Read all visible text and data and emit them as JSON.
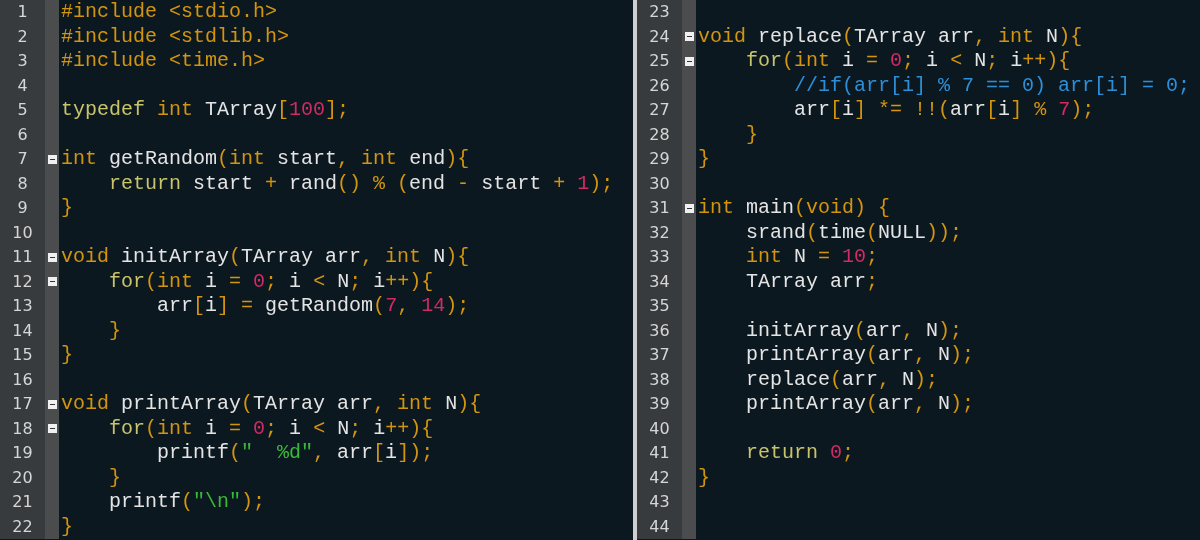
{
  "panes": [
    {
      "lines": [
        {
          "number": "1",
          "fold": false,
          "tokens": [
            {
              "text": "#include <stdio.h>",
              "kind": "pp"
            }
          ]
        },
        {
          "number": "2",
          "fold": false,
          "tokens": [
            {
              "text": "#include <stdlib.h>",
              "kind": "pp"
            }
          ]
        },
        {
          "number": "3",
          "fold": false,
          "tokens": [
            {
              "text": "#include <time.h>",
              "kind": "pp"
            }
          ]
        },
        {
          "number": "4",
          "fold": false
        },
        {
          "number": "5",
          "fold": false,
          "tokens": [
            {
              "text": "typedef",
              "kind": "kw"
            },
            {
              "text": " int",
              "kind": "type"
            },
            {
              "text": " TArray",
              "kind": "id"
            },
            {
              "text": "[",
              "kind": "op"
            },
            {
              "text": "100",
              "kind": "num"
            },
            {
              "text": "];",
              "kind": "op"
            }
          ]
        },
        {
          "number": "6",
          "fold": false
        },
        {
          "number": "7",
          "fold": true,
          "tokens": [
            {
              "text": "int",
              "kind": "type"
            },
            {
              "text": " getRandom",
              "kind": "id"
            },
            {
              "text": "(",
              "kind": "op"
            },
            {
              "text": "int",
              "kind": "type"
            },
            {
              "text": " start",
              "kind": "id"
            },
            {
              "text": ",",
              "kind": "op"
            },
            {
              "text": " int",
              "kind": "type"
            },
            {
              "text": " end",
              "kind": "id"
            },
            {
              "text": "){",
              "kind": "op"
            }
          ]
        },
        {
          "number": "8",
          "fold": false,
          "tokens": [
            {
              "text": "    return",
              "kind": "kw"
            },
            {
              "text": " start ",
              "kind": "id"
            },
            {
              "text": "+",
              "kind": "op"
            },
            {
              "text": " rand",
              "kind": "id"
            },
            {
              "text": "() % (",
              "kind": "op"
            },
            {
              "text": "end ",
              "kind": "id"
            },
            {
              "text": "-",
              "kind": "op"
            },
            {
              "text": " start ",
              "kind": "id"
            },
            {
              "text": "+",
              "kind": "op"
            },
            {
              "text": " 1",
              "kind": "num"
            },
            {
              "text": ");",
              "kind": "op"
            }
          ]
        },
        {
          "number": "9",
          "fold": false,
          "tokens": [
            {
              "text": "}",
              "kind": "op"
            }
          ]
        },
        {
          "number": "10",
          "fold": false
        },
        {
          "number": "11",
          "fold": true,
          "tokens": [
            {
              "text": "void",
              "kind": "type"
            },
            {
              "text": " initArray",
              "kind": "id"
            },
            {
              "text": "(",
              "kind": "op"
            },
            {
              "text": "TArray arr",
              "kind": "id"
            },
            {
              "text": ",",
              "kind": "op"
            },
            {
              "text": " int",
              "kind": "type"
            },
            {
              "text": " N",
              "kind": "id"
            },
            {
              "text": "){",
              "kind": "op"
            }
          ]
        },
        {
          "number": "12",
          "fold": true,
          "tokens": [
            {
              "text": "    for",
              "kind": "kw"
            },
            {
              "text": "(",
              "kind": "op"
            },
            {
              "text": "int",
              "kind": "type"
            },
            {
              "text": " i ",
              "kind": "id"
            },
            {
              "text": "=",
              "kind": "op"
            },
            {
              "text": " 0",
              "kind": "num"
            },
            {
              "text": ";",
              "kind": "op"
            },
            {
              "text": " i ",
              "kind": "id"
            },
            {
              "text": "<",
              "kind": "op"
            },
            {
              "text": " N",
              "kind": "id"
            },
            {
              "text": ";",
              "kind": "op"
            },
            {
              "text": " i",
              "kind": "id"
            },
            {
              "text": "++){",
              "kind": "op"
            }
          ]
        },
        {
          "number": "13",
          "fold": false,
          "tokens": [
            {
              "text": "        arr",
              "kind": "id"
            },
            {
              "text": "[",
              "kind": "op"
            },
            {
              "text": "i",
              "kind": "id"
            },
            {
              "text": "] =",
              "kind": "op"
            },
            {
              "text": " getRandom",
              "kind": "id"
            },
            {
              "text": "(",
              "kind": "op"
            },
            {
              "text": "7",
              "kind": "num"
            },
            {
              "text": ",",
              "kind": "op"
            },
            {
              "text": " 14",
              "kind": "num"
            },
            {
              "text": ");",
              "kind": "op"
            }
          ]
        },
        {
          "number": "14",
          "fold": false,
          "tokens": [
            {
              "text": "    }",
              "kind": "op"
            }
          ]
        },
        {
          "number": "15",
          "fold": false,
          "tokens": [
            {
              "text": "}",
              "kind": "op"
            }
          ]
        },
        {
          "number": "16",
          "fold": false
        },
        {
          "number": "17",
          "fold": true,
          "tokens": [
            {
              "text": "void",
              "kind": "type"
            },
            {
              "text": " printArray",
              "kind": "id"
            },
            {
              "text": "(",
              "kind": "op"
            },
            {
              "text": "TArray arr",
              "kind": "id"
            },
            {
              "text": ",",
              "kind": "op"
            },
            {
              "text": " int",
              "kind": "type"
            },
            {
              "text": " N",
              "kind": "id"
            },
            {
              "text": "){",
              "kind": "op"
            }
          ]
        },
        {
          "number": "18",
          "fold": true,
          "tokens": [
            {
              "text": "    for",
              "kind": "kw"
            },
            {
              "text": "(",
              "kind": "op"
            },
            {
              "text": "int",
              "kind": "type"
            },
            {
              "text": " i ",
              "kind": "id"
            },
            {
              "text": "=",
              "kind": "op"
            },
            {
              "text": " 0",
              "kind": "num"
            },
            {
              "text": ";",
              "kind": "op"
            },
            {
              "text": " i ",
              "kind": "id"
            },
            {
              "text": "<",
              "kind": "op"
            },
            {
              "text": " N",
              "kind": "id"
            },
            {
              "text": ";",
              "kind": "op"
            },
            {
              "text": " i",
              "kind": "id"
            },
            {
              "text": "++){",
              "kind": "op"
            }
          ]
        },
        {
          "number": "19",
          "fold": false,
          "tokens": [
            {
              "text": "        printf",
              "kind": "id"
            },
            {
              "text": "(",
              "kind": "op"
            },
            {
              "text": "\"  %d\"",
              "kind": "str"
            },
            {
              "text": ",",
              "kind": "op"
            },
            {
              "text": " arr",
              "kind": "id"
            },
            {
              "text": "[",
              "kind": "op"
            },
            {
              "text": "i",
              "kind": "id"
            },
            {
              "text": "]);",
              "kind": "op"
            }
          ]
        },
        {
          "number": "20",
          "fold": false,
          "tokens": [
            {
              "text": "    }",
              "kind": "op"
            }
          ]
        },
        {
          "number": "21",
          "fold": false,
          "tokens": [
            {
              "text": "    printf",
              "kind": "id"
            },
            {
              "text": "(",
              "kind": "op"
            },
            {
              "text": "\"\\n\"",
              "kind": "str"
            },
            {
              "text": ");",
              "kind": "op"
            }
          ]
        },
        {
          "number": "22",
          "fold": false,
          "tokens": [
            {
              "text": "}",
              "kind": "op"
            }
          ]
        }
      ]
    },
    {
      "lines": [
        {
          "number": "23",
          "fold": false
        },
        {
          "number": "24",
          "fold": true,
          "tokens": [
            {
              "text": "void",
              "kind": "type"
            },
            {
              "text": " replace",
              "kind": "id"
            },
            {
              "text": "(",
              "kind": "op"
            },
            {
              "text": "TArray arr",
              "kind": "id"
            },
            {
              "text": ",",
              "kind": "op"
            },
            {
              "text": " int",
              "kind": "type"
            },
            {
              "text": " N",
              "kind": "id"
            },
            {
              "text": "){",
              "kind": "op"
            }
          ]
        },
        {
          "number": "25",
          "fold": true,
          "tokens": [
            {
              "text": "    for",
              "kind": "kw"
            },
            {
              "text": "(",
              "kind": "op"
            },
            {
              "text": "int",
              "kind": "type"
            },
            {
              "text": " i ",
              "kind": "id"
            },
            {
              "text": "=",
              "kind": "op"
            },
            {
              "text": " 0",
              "kind": "num"
            },
            {
              "text": ";",
              "kind": "op"
            },
            {
              "text": " i ",
              "kind": "id"
            },
            {
              "text": "<",
              "kind": "op"
            },
            {
              "text": " N",
              "kind": "id"
            },
            {
              "text": ";",
              "kind": "op"
            },
            {
              "text": " i",
              "kind": "id"
            },
            {
              "text": "++){",
              "kind": "op"
            }
          ]
        },
        {
          "number": "26",
          "fold": false,
          "tokens": [
            {
              "text": "        //if(arr[i] % 7 == 0) arr[i] = 0;",
              "kind": "cmt"
            }
          ]
        },
        {
          "number": "27",
          "fold": false,
          "tokens": [
            {
              "text": "        arr",
              "kind": "id"
            },
            {
              "text": "[",
              "kind": "op"
            },
            {
              "text": "i",
              "kind": "id"
            },
            {
              "text": "] *= !!(",
              "kind": "op"
            },
            {
              "text": "arr",
              "kind": "id"
            },
            {
              "text": "[",
              "kind": "op"
            },
            {
              "text": "i",
              "kind": "id"
            },
            {
              "text": "] %",
              "kind": "op"
            },
            {
              "text": " 7",
              "kind": "num"
            },
            {
              "text": ");",
              "kind": "op"
            }
          ]
        },
        {
          "number": "28",
          "fold": false,
          "tokens": [
            {
              "text": "    }",
              "kind": "op"
            }
          ]
        },
        {
          "number": "29",
          "fold": false,
          "tokens": [
            {
              "text": "}",
              "kind": "op"
            }
          ]
        },
        {
          "number": "30",
          "fold": false
        },
        {
          "number": "31",
          "fold": true,
          "tokens": [
            {
              "text": "int",
              "kind": "type"
            },
            {
              "text": " main",
              "kind": "id"
            },
            {
              "text": "(",
              "kind": "op"
            },
            {
              "text": "void",
              "kind": "type"
            },
            {
              "text": ") {",
              "kind": "op"
            }
          ]
        },
        {
          "number": "32",
          "fold": false,
          "tokens": [
            {
              "text": "    srand",
              "kind": "id"
            },
            {
              "text": "(",
              "kind": "op"
            },
            {
              "text": "time",
              "kind": "id"
            },
            {
              "text": "(",
              "kind": "op"
            },
            {
              "text": "NULL",
              "kind": "id"
            },
            {
              "text": "));",
              "kind": "op"
            }
          ]
        },
        {
          "number": "33",
          "fold": false,
          "tokens": [
            {
              "text": "    int",
              "kind": "type"
            },
            {
              "text": " N ",
              "kind": "id"
            },
            {
              "text": "=",
              "kind": "op"
            },
            {
              "text": " 10",
              "kind": "num"
            },
            {
              "text": ";",
              "kind": "op"
            }
          ]
        },
        {
          "number": "34",
          "fold": false,
          "tokens": [
            {
              "text": "    TArray arr",
              "kind": "id"
            },
            {
              "text": ";",
              "kind": "op"
            }
          ]
        },
        {
          "number": "35",
          "fold": false
        },
        {
          "number": "36",
          "fold": false,
          "tokens": [
            {
              "text": "    initArray",
              "kind": "id"
            },
            {
              "text": "(",
              "kind": "op"
            },
            {
              "text": "arr",
              "kind": "id"
            },
            {
              "text": ",",
              "kind": "op"
            },
            {
              "text": " N",
              "kind": "id"
            },
            {
              "text": ");",
              "kind": "op"
            }
          ]
        },
        {
          "number": "37",
          "fold": false,
          "tokens": [
            {
              "text": "    printArray",
              "kind": "id"
            },
            {
              "text": "(",
              "kind": "op"
            },
            {
              "text": "arr",
              "kind": "id"
            },
            {
              "text": ",",
              "kind": "op"
            },
            {
              "text": " N",
              "kind": "id"
            },
            {
              "text": ");",
              "kind": "op"
            }
          ]
        },
        {
          "number": "38",
          "fold": false,
          "tokens": [
            {
              "text": "    replace",
              "kind": "id"
            },
            {
              "text": "(",
              "kind": "op"
            },
            {
              "text": "arr",
              "kind": "id"
            },
            {
              "text": ",",
              "kind": "op"
            },
            {
              "text": " N",
              "kind": "id"
            },
            {
              "text": ");",
              "kind": "op"
            }
          ]
        },
        {
          "number": "39",
          "fold": false,
          "tokens": [
            {
              "text": "    printArray",
              "kind": "id"
            },
            {
              "text": "(",
              "kind": "op"
            },
            {
              "text": "arr",
              "kind": "id"
            },
            {
              "text": ",",
              "kind": "op"
            },
            {
              "text": " N",
              "kind": "id"
            },
            {
              "text": ");",
              "kind": "op"
            }
          ]
        },
        {
          "number": "40",
          "fold": false
        },
        {
          "number": "41",
          "fold": false,
          "tokens": [
            {
              "text": "    return",
              "kind": "kw"
            },
            {
              "text": " 0",
              "kind": "num"
            },
            {
              "text": ";",
              "kind": "op"
            }
          ]
        },
        {
          "number": "42",
          "fold": false,
          "tokens": [
            {
              "text": "}",
              "kind": "op"
            }
          ]
        },
        {
          "number": "43",
          "fold": false
        },
        {
          "number": "44",
          "fold": false
        }
      ]
    }
  ]
}
